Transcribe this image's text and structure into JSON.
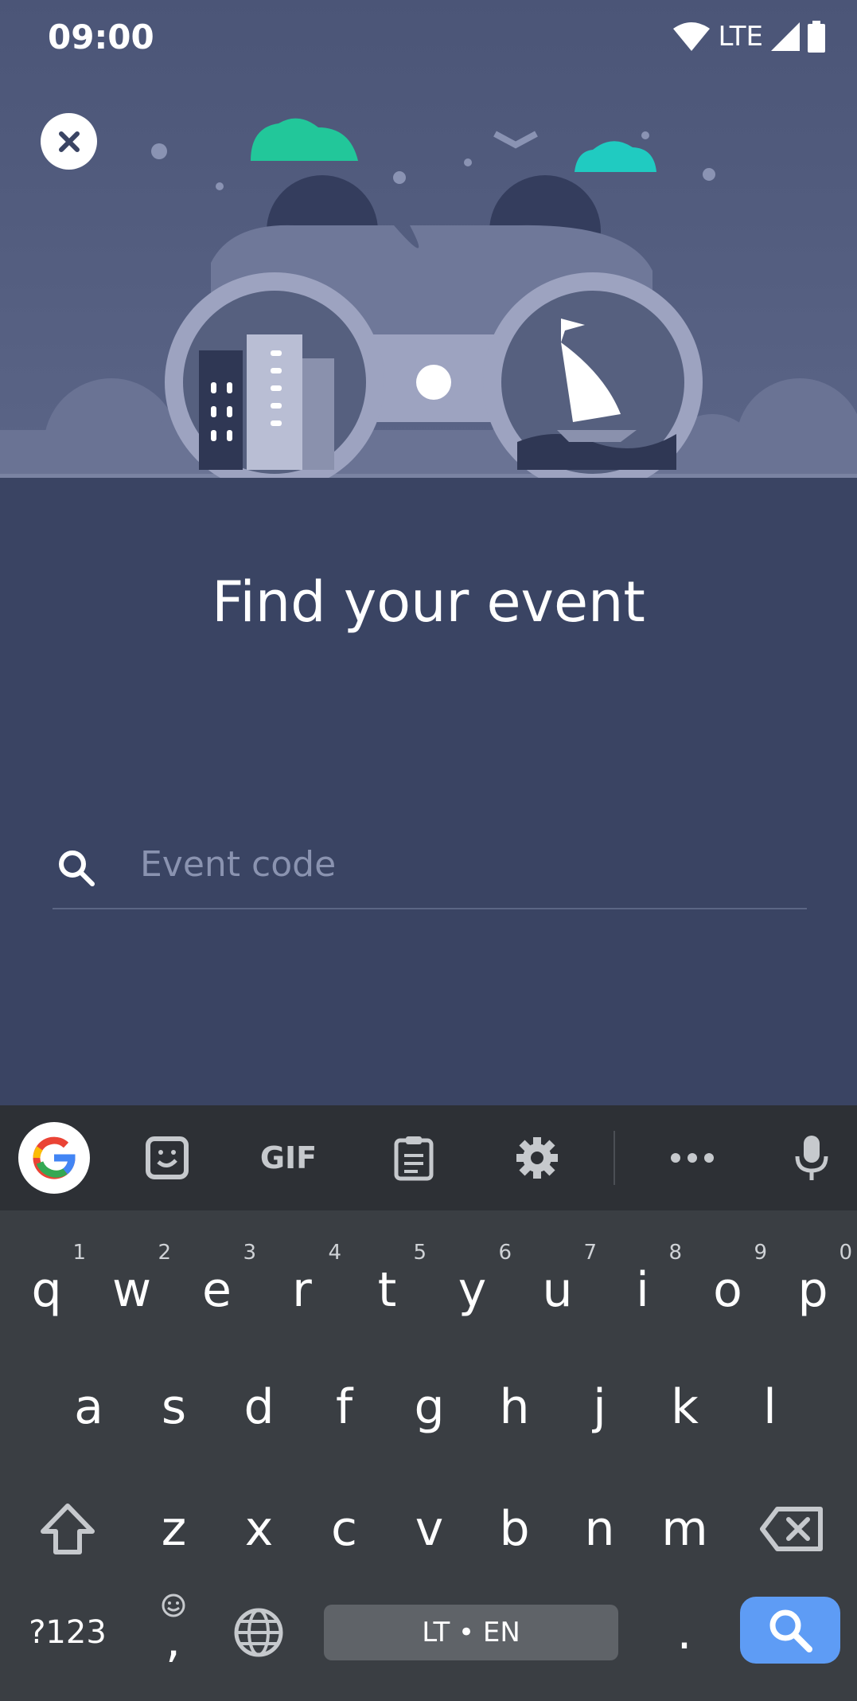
{
  "status_bar": {
    "time": "09:00",
    "network": "LTE"
  },
  "page": {
    "title": "Find your event"
  },
  "search": {
    "placeholder": "Event code",
    "value": ""
  },
  "keyboard": {
    "row1": [
      {
        "letter": "q",
        "hint": "1"
      },
      {
        "letter": "w",
        "hint": "2"
      },
      {
        "letter": "e",
        "hint": "3"
      },
      {
        "letter": "r",
        "hint": "4"
      },
      {
        "letter": "t",
        "hint": "5"
      },
      {
        "letter": "y",
        "hint": "6"
      },
      {
        "letter": "u",
        "hint": "7"
      },
      {
        "letter": "i",
        "hint": "8"
      },
      {
        "letter": "o",
        "hint": "9"
      },
      {
        "letter": "p",
        "hint": "0"
      }
    ],
    "row2": [
      "a",
      "s",
      "d",
      "f",
      "g",
      "h",
      "j",
      "k",
      "l"
    ],
    "row3": [
      "z",
      "x",
      "c",
      "v",
      "b",
      "n",
      "m"
    ],
    "symbols_label": "?123",
    "comma": ",",
    "space_label": "LT • EN",
    "period": ".",
    "toolbar_gif": "GIF"
  },
  "colors": {
    "background": "#3a4463",
    "accent_search": "#5e9cf5"
  }
}
